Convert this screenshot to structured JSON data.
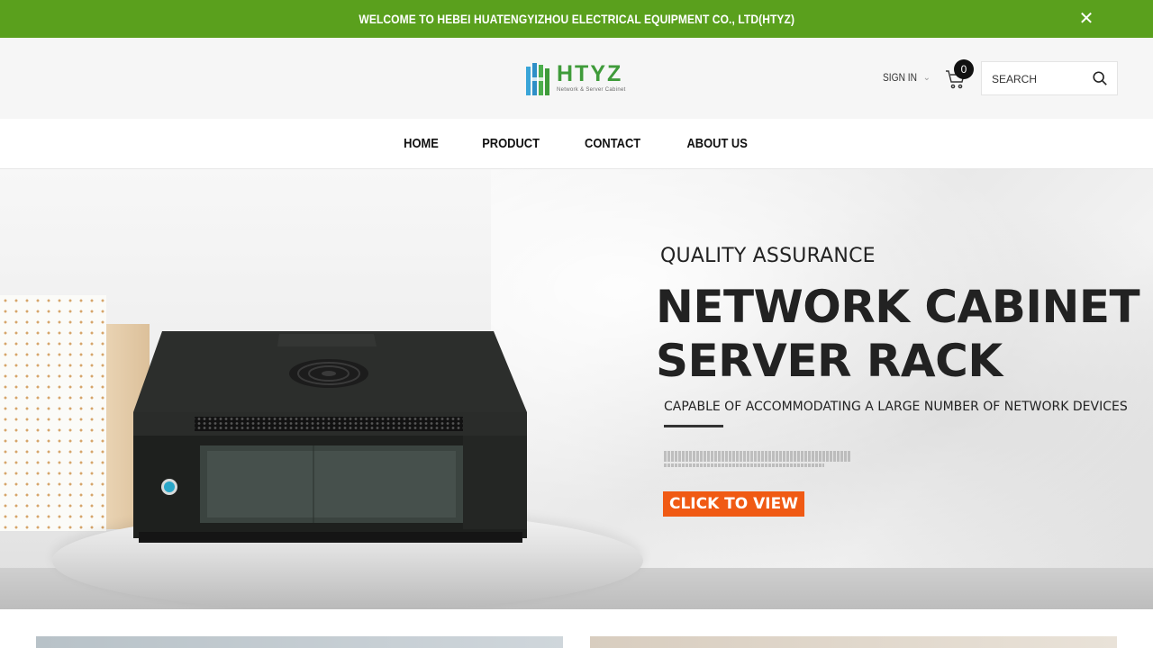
{
  "announcement": {
    "text": "WELCOME TO HEBEI HUATENGYIZHOU ELECTRICAL EQUIPMENT CO., LTD(HTYZ)",
    "close_icon": "close-icon",
    "bg_color": "#5aa01d"
  },
  "header": {
    "logo": {
      "word": "HTYZ",
      "tagline": "Network & Server Cabinet"
    },
    "signin_label": "SIGN IN",
    "cart_count": "0",
    "search": {
      "placeholder": "SEARCH",
      "value": ""
    }
  },
  "nav": {
    "items": [
      {
        "label": "HOME"
      },
      {
        "label": "PRODUCT"
      },
      {
        "label": "CONTACT"
      },
      {
        "label": "ABOUT US"
      }
    ]
  },
  "hero": {
    "kicker": "QUALITY ASSURANCE",
    "headline_line1": "NETWORK CABINET",
    "headline_line2": "SERVER RACK",
    "subtitle": "CAPABLE OF ACCOMMODATING A LARGE NUMBER OF NETWORK DEVICES",
    "cta_label": "CLICK TO VIEW",
    "cta_color": "#f05a14"
  }
}
